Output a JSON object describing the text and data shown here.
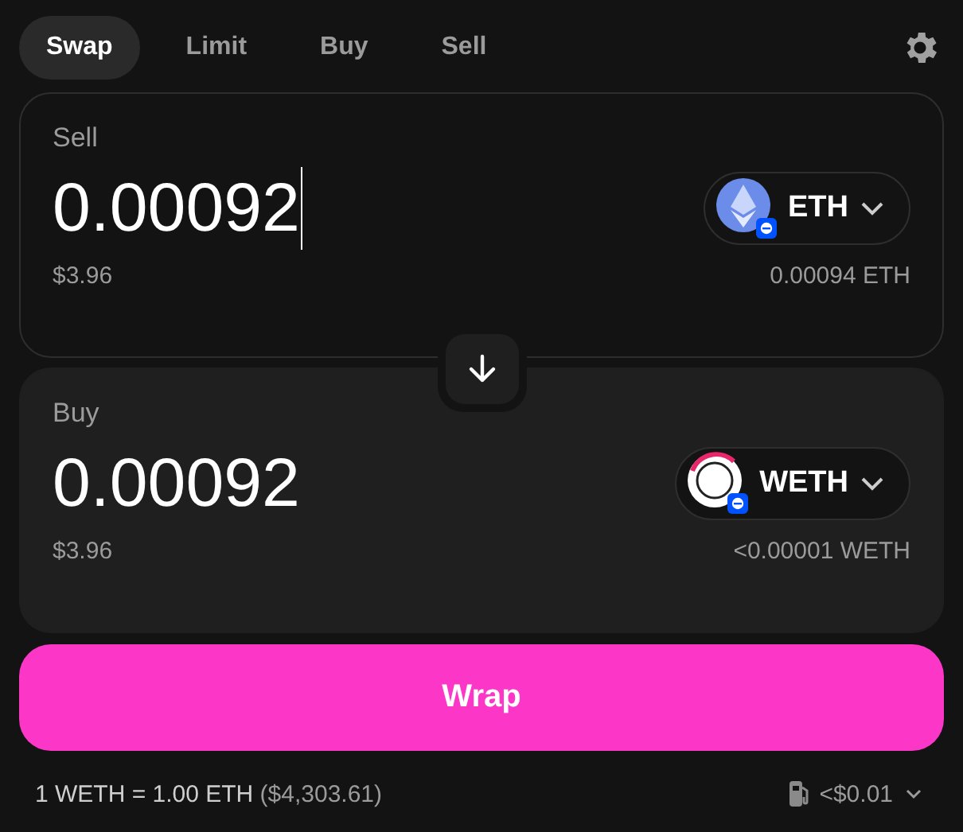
{
  "tabs": [
    {
      "label": "Swap",
      "selected": true
    },
    {
      "label": "Limit",
      "selected": false
    },
    {
      "label": "Buy",
      "selected": false
    },
    {
      "label": "Sell",
      "selected": false
    }
  ],
  "panels": [
    {
      "kind": "outlined",
      "label": "Sell",
      "amount": "0.00092",
      "focused": true,
      "token": {
        "symbol": "ETH",
        "kind": "eth"
      },
      "usd_value": "$3.96",
      "balance": "0.00094 ETH"
    },
    {
      "kind": "filled",
      "label": "Buy",
      "amount": "0.00092",
      "focused": false,
      "token": {
        "symbol": "WETH",
        "kind": "weth"
      },
      "usd_value": "$3.96",
      "balance": "<0.00001 WETH"
    }
  ],
  "action_button": "Wrap",
  "footer": {
    "rate": "1 WETH = 1.00 ETH",
    "rate_usd": "($4,303.61)",
    "network_fee": "<$0.01"
  }
}
